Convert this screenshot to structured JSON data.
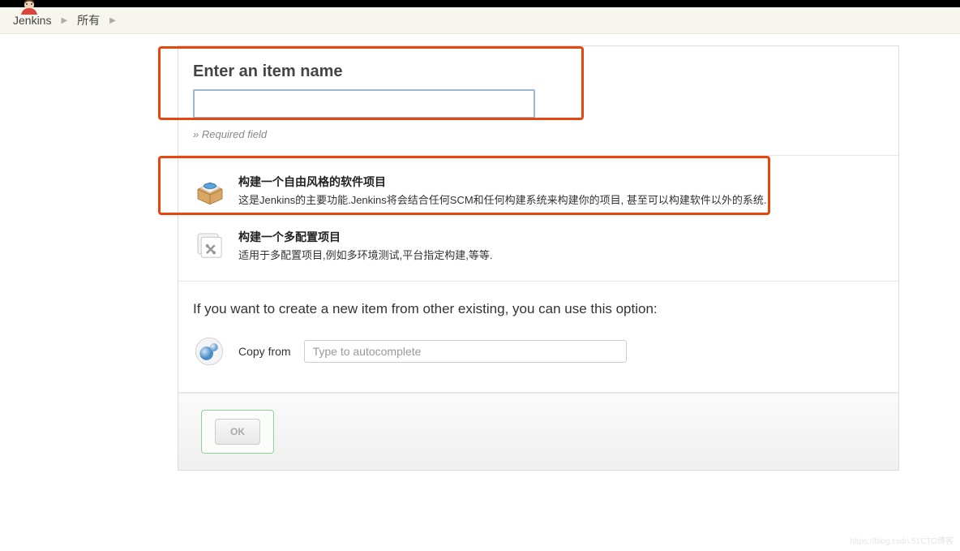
{
  "breadcrumb": {
    "items": [
      "Jenkins",
      "所有"
    ]
  },
  "header": {
    "title": "Enter an item name",
    "required_note": "» Required field"
  },
  "name_input": {
    "value": ""
  },
  "options": [
    {
      "title": "构建一个自由风格的软件项目",
      "desc": "这是Jenkins的主要功能.Jenkins将会结合任何SCM和任何构建系统来构建你的项目, 甚至可以构建软件以外的系统."
    },
    {
      "title": "构建一个多配置项目",
      "desc": "适用于多配置项目,例如多环境测试,平台指定构建,等等."
    }
  ],
  "copy_section": {
    "heading": "If you want to create a new item from other existing, you can use this option:",
    "label": "Copy from",
    "placeholder": "Type to autocomplete"
  },
  "footer": {
    "ok_label": "OK"
  },
  "watermark": "https://blog.csdn.51CTO博客"
}
